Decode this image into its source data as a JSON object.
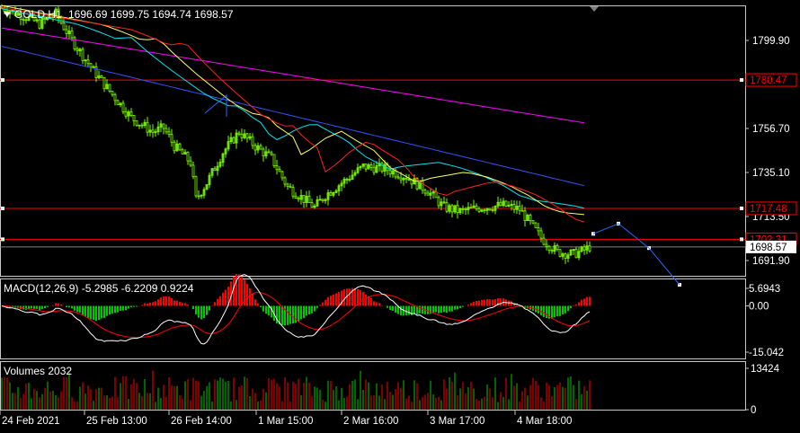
{
  "chart_data": [
    {
      "type": "candlestick",
      "panel": "main",
      "symbol_header": "GOLD,H1",
      "ohlc_header": "1696.69 1699.75 1694.74 1698.57",
      "ylim": [
        1680,
        1830
      ],
      "y_ticks": [
        "1799.90",
        "1756.70",
        "1735.10",
        "1713.50",
        "1691.90"
      ],
      "x_ticks": [
        "24 Feb 2021",
        "25 Feb 13:00",
        "26 Feb 14:00",
        "1 Mar 15:00",
        "2 Mar 16:00",
        "3 Mar 17:00",
        "4 Mar 18:00"
      ],
      "grid": false,
      "candle_color": "#7cfc00",
      "horizontal_levels": [
        {
          "price": 1780.47,
          "label": "1780.47",
          "color": "#ff0000"
        },
        {
          "price": 1717.48,
          "label": "1717.48",
          "color": "#ff0000"
        },
        {
          "price": 1702.31,
          "label": "1702.31",
          "color": "#ff0000"
        }
      ],
      "current_price": {
        "price": 1698.57,
        "label": "1698.57",
        "color": "#ffffff"
      },
      "moving_averages": [
        {
          "color": "#ff00ff",
          "start": 1806,
          "end": 1759
        },
        {
          "color": "#3355ff",
          "start": 1797,
          "end": 1728
        },
        {
          "color": "#00e5ee",
          "start": 1815,
          "end": 1716
        },
        {
          "color": "#ffff66",
          "start": 1818,
          "end": 1710
        },
        {
          "color": "#ff2020",
          "start": 1816,
          "end": 1702
        }
      ],
      "projection": {
        "color": "#1e6bff",
        "points": [
          1705,
          1710,
          1698,
          1680
        ]
      }
    },
    {
      "type": "bar",
      "panel": "macd",
      "title": "MACD(12,26,9) -5.2985 -6.2209 0.9224",
      "ylim": [
        -15.042,
        5.6943
      ],
      "y_ticks": [
        "5.6943",
        "0.00",
        "-15.042"
      ],
      "histogram_up_color": "#ff0000",
      "histogram_down_color": "#00c800",
      "signal_color": "#ff0000",
      "main_color": "#ffffff"
    },
    {
      "type": "bar",
      "panel": "volumes",
      "title": "Volumes 2032",
      "ylim": [
        0,
        13424
      ],
      "y_ticks": [
        "13424",
        "0"
      ],
      "up_color": "#00c800",
      "down_color": "#ff0000"
    }
  ]
}
